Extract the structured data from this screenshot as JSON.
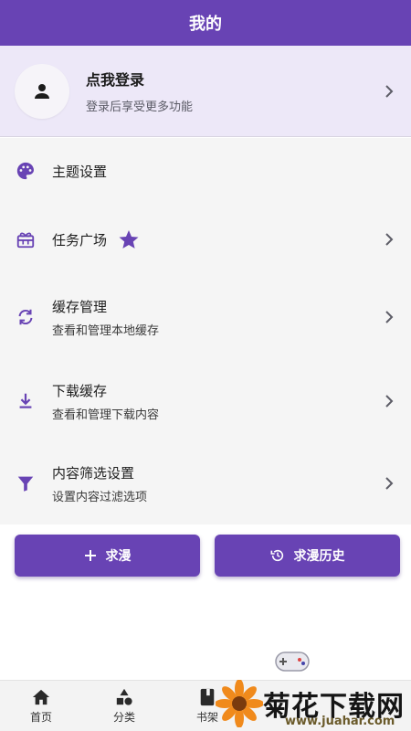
{
  "header": {
    "title": "我的"
  },
  "login": {
    "title": "点我登录",
    "subtitle": "登录后享受更多功能"
  },
  "menu": [
    {
      "title": "主题设置",
      "icon": "palette-icon"
    },
    {
      "title": "任务广场",
      "icon": "gift-icon",
      "badge_icon": "star-icon"
    },
    {
      "title": "缓存管理",
      "subtitle": "查看和管理本地缓存",
      "icon": "sync-icon"
    },
    {
      "title": "下载缓存",
      "subtitle": "查看和管理下载内容",
      "icon": "download-icon"
    },
    {
      "title": "内容筛选设置",
      "subtitle": "设置内容过滤选项",
      "icon": "filter-icon"
    }
  ],
  "actions": {
    "request_label": "求漫",
    "history_label": "求漫历史"
  },
  "nav": [
    {
      "label": "首页",
      "icon": "home-icon"
    },
    {
      "label": "分类",
      "icon": "category-icon"
    },
    {
      "label": "书架",
      "icon": "book-icon"
    }
  ],
  "watermark": {
    "text": "菊花下载网",
    "url": "www.juahar.com"
  },
  "colors": {
    "accent": "#6843b4",
    "accent_light": "#ede8f8",
    "background": "#f5f5f5"
  }
}
